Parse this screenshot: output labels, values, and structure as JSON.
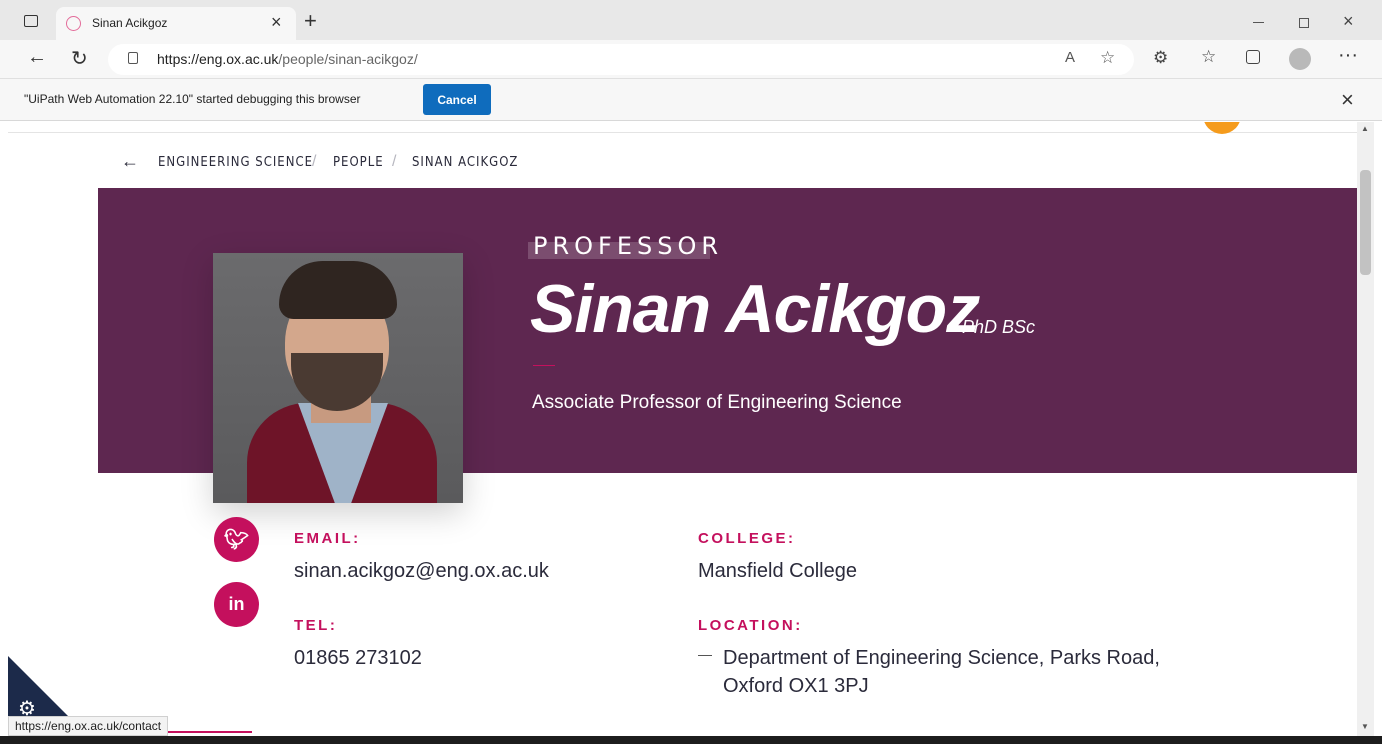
{
  "browser": {
    "tab_title": "Sinan Acikgoz",
    "url_host": "https://eng.ox.ac.uk",
    "url_path": "/people/sinan-acikgoz/",
    "infobar_message": "\"UiPath Web Automation 22.10\" started debugging this browser",
    "cancel_label": "Cancel",
    "status_url": "https://eng.ox.ac.uk/contact"
  },
  "breadcrumb": {
    "items": [
      "ENGINEERING SCIENCE",
      "PEOPLE",
      "SINAN ACIKGOZ"
    ],
    "separator": "/"
  },
  "profile": {
    "role": "PROFESSOR",
    "name": "Sinan Acikgoz",
    "degrees": "PhD BSc",
    "position": "Associate Professor of Engineering Science"
  },
  "contact": {
    "email_label": "EMAIL:",
    "email": "sinan.acikgoz@eng.ox.ac.uk",
    "tel_label": "TEL:",
    "tel": "01865 273102",
    "college_label": "COLLEGE:",
    "college": "Mansfield College",
    "location_label": "LOCATION:",
    "location_line1": "Department of Engineering Science, Parks Road,",
    "location_line2": "Oxford OX1 3PJ"
  },
  "social": {
    "twitter_icon": "twitter-icon",
    "linkedin_icon": "linkedin-icon",
    "linkedin_glyph": "in"
  },
  "colors": {
    "hero_bg": "#5e2750",
    "accent_pink": "#c4105d",
    "edge_blue": "#0f6cbd"
  }
}
